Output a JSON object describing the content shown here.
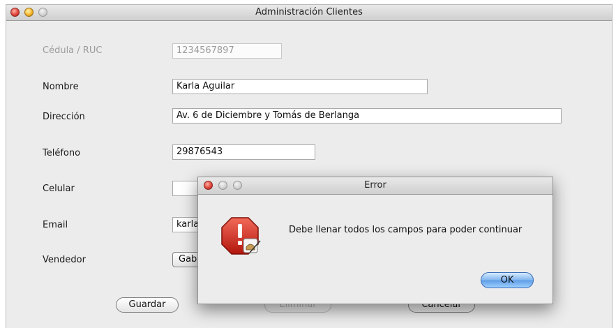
{
  "window": {
    "title": "Administración Clientes"
  },
  "form": {
    "cedula_label": "Cédula / RUC",
    "cedula_value": "1234567897",
    "nombre_label": "Nombre",
    "nombre_value": "Karla Aguilar",
    "direccion_label": "Dirección",
    "direccion_value": "Av. 6 de Diciembre y Tomás de Berlanga",
    "telefono_label": "Teléfono",
    "telefono_value": "29876543",
    "celular_label": "Celular",
    "celular_value": "",
    "email_label": "Email",
    "email_value": "karla",
    "vendedor_label": "Vendedor",
    "vendedor_value": "Gab"
  },
  "buttons": {
    "guardar": "Guardar",
    "eliminar": "Eliminar",
    "cancelar": "Cancelar"
  },
  "dialog": {
    "title": "Error",
    "message": "Debe  llenar todos los campos para poder continuar",
    "ok": "OK",
    "icon": "stop-warning-icon"
  }
}
